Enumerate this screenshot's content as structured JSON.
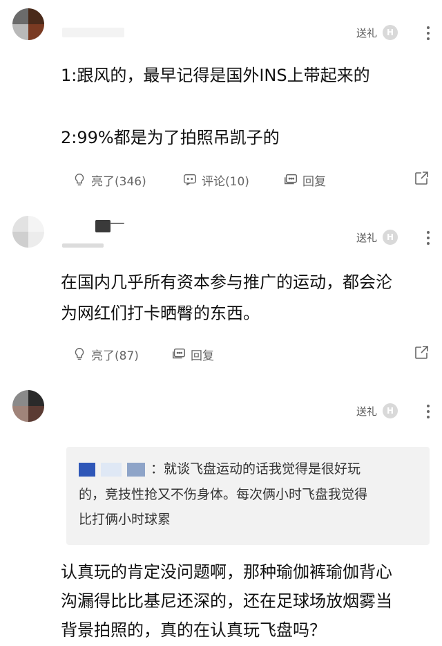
{
  "comments": [
    {
      "gift_label": "送礼",
      "gift_icon": "H",
      "lines": [
        "1:跟风的，最早记得是国外INS上带起来的",
        "",
        "2:99%都是为了拍照吊凯子的"
      ],
      "like_label": "亮了(346)",
      "comment_label": "评论(10)",
      "reply_label": "回复"
    },
    {
      "gift_label": "送礼",
      "gift_icon": "H",
      "lines": [
        "在国内几乎所有资本参与推广的运动，都会沦",
        "为网红们打卡晒臀的东西。"
      ],
      "like_label": "亮了(87)",
      "reply_label": "回复"
    },
    {
      "gift_label": "送礼",
      "gift_icon": "H",
      "quote_lines": [
        "：就谈飞盘运动的话我觉得是很好玩",
        "的，竞技性抢又不伤身体。每次俩小时飞盘我觉得",
        "比打俩小时球累"
      ],
      "lines": [
        "认真玩的肯定没问题啊，那种瑜伽裤瑜伽背心",
        "沟漏得比比基尼还深的，还在足球场放烟雾当",
        "背景拍照的，真的在认真玩飞盘吗？"
      ]
    }
  ],
  "icons": {
    "like": "lightbulb-icon",
    "comment": "chat-bubble-icon",
    "reply": "reply-icon",
    "share": "share-icon",
    "more": "more-vertical-icon"
  }
}
